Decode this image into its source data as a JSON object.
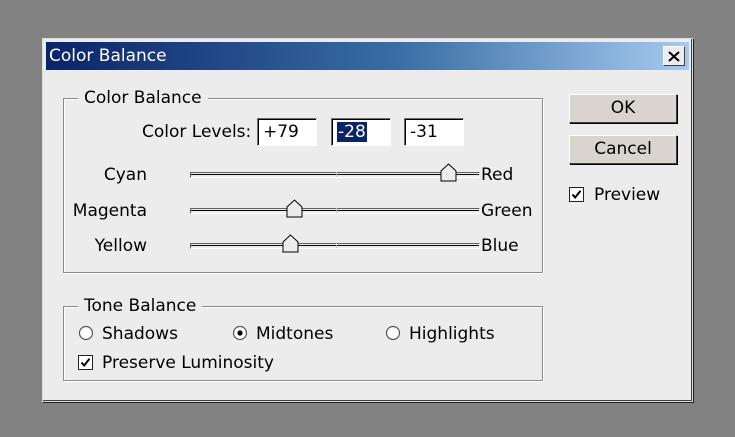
{
  "window": {
    "title": "Color Balance"
  },
  "icons": {
    "close": "close-icon"
  },
  "color_balance": {
    "legend": "Color Balance",
    "levels_label": "Color Levels:",
    "levels": [
      "+79",
      "-28",
      "-31"
    ],
    "sliders": [
      {
        "left": "Cyan",
        "right": "Red",
        "value": 79
      },
      {
        "left": "Magenta",
        "right": "Green",
        "value": -28
      },
      {
        "left": "Yellow",
        "right": "Blue",
        "value": -31
      }
    ]
  },
  "tone_balance": {
    "legend": "Tone Balance",
    "options": [
      "Shadows",
      "Midtones",
      "Highlights"
    ],
    "selected": "Midtones",
    "preserve_luminosity_label": "Preserve Luminosity",
    "preserve_luminosity_checked": true
  },
  "buttons": {
    "ok": "OK",
    "cancel": "Cancel"
  },
  "preview": {
    "label": "Preview",
    "checked": true
  }
}
